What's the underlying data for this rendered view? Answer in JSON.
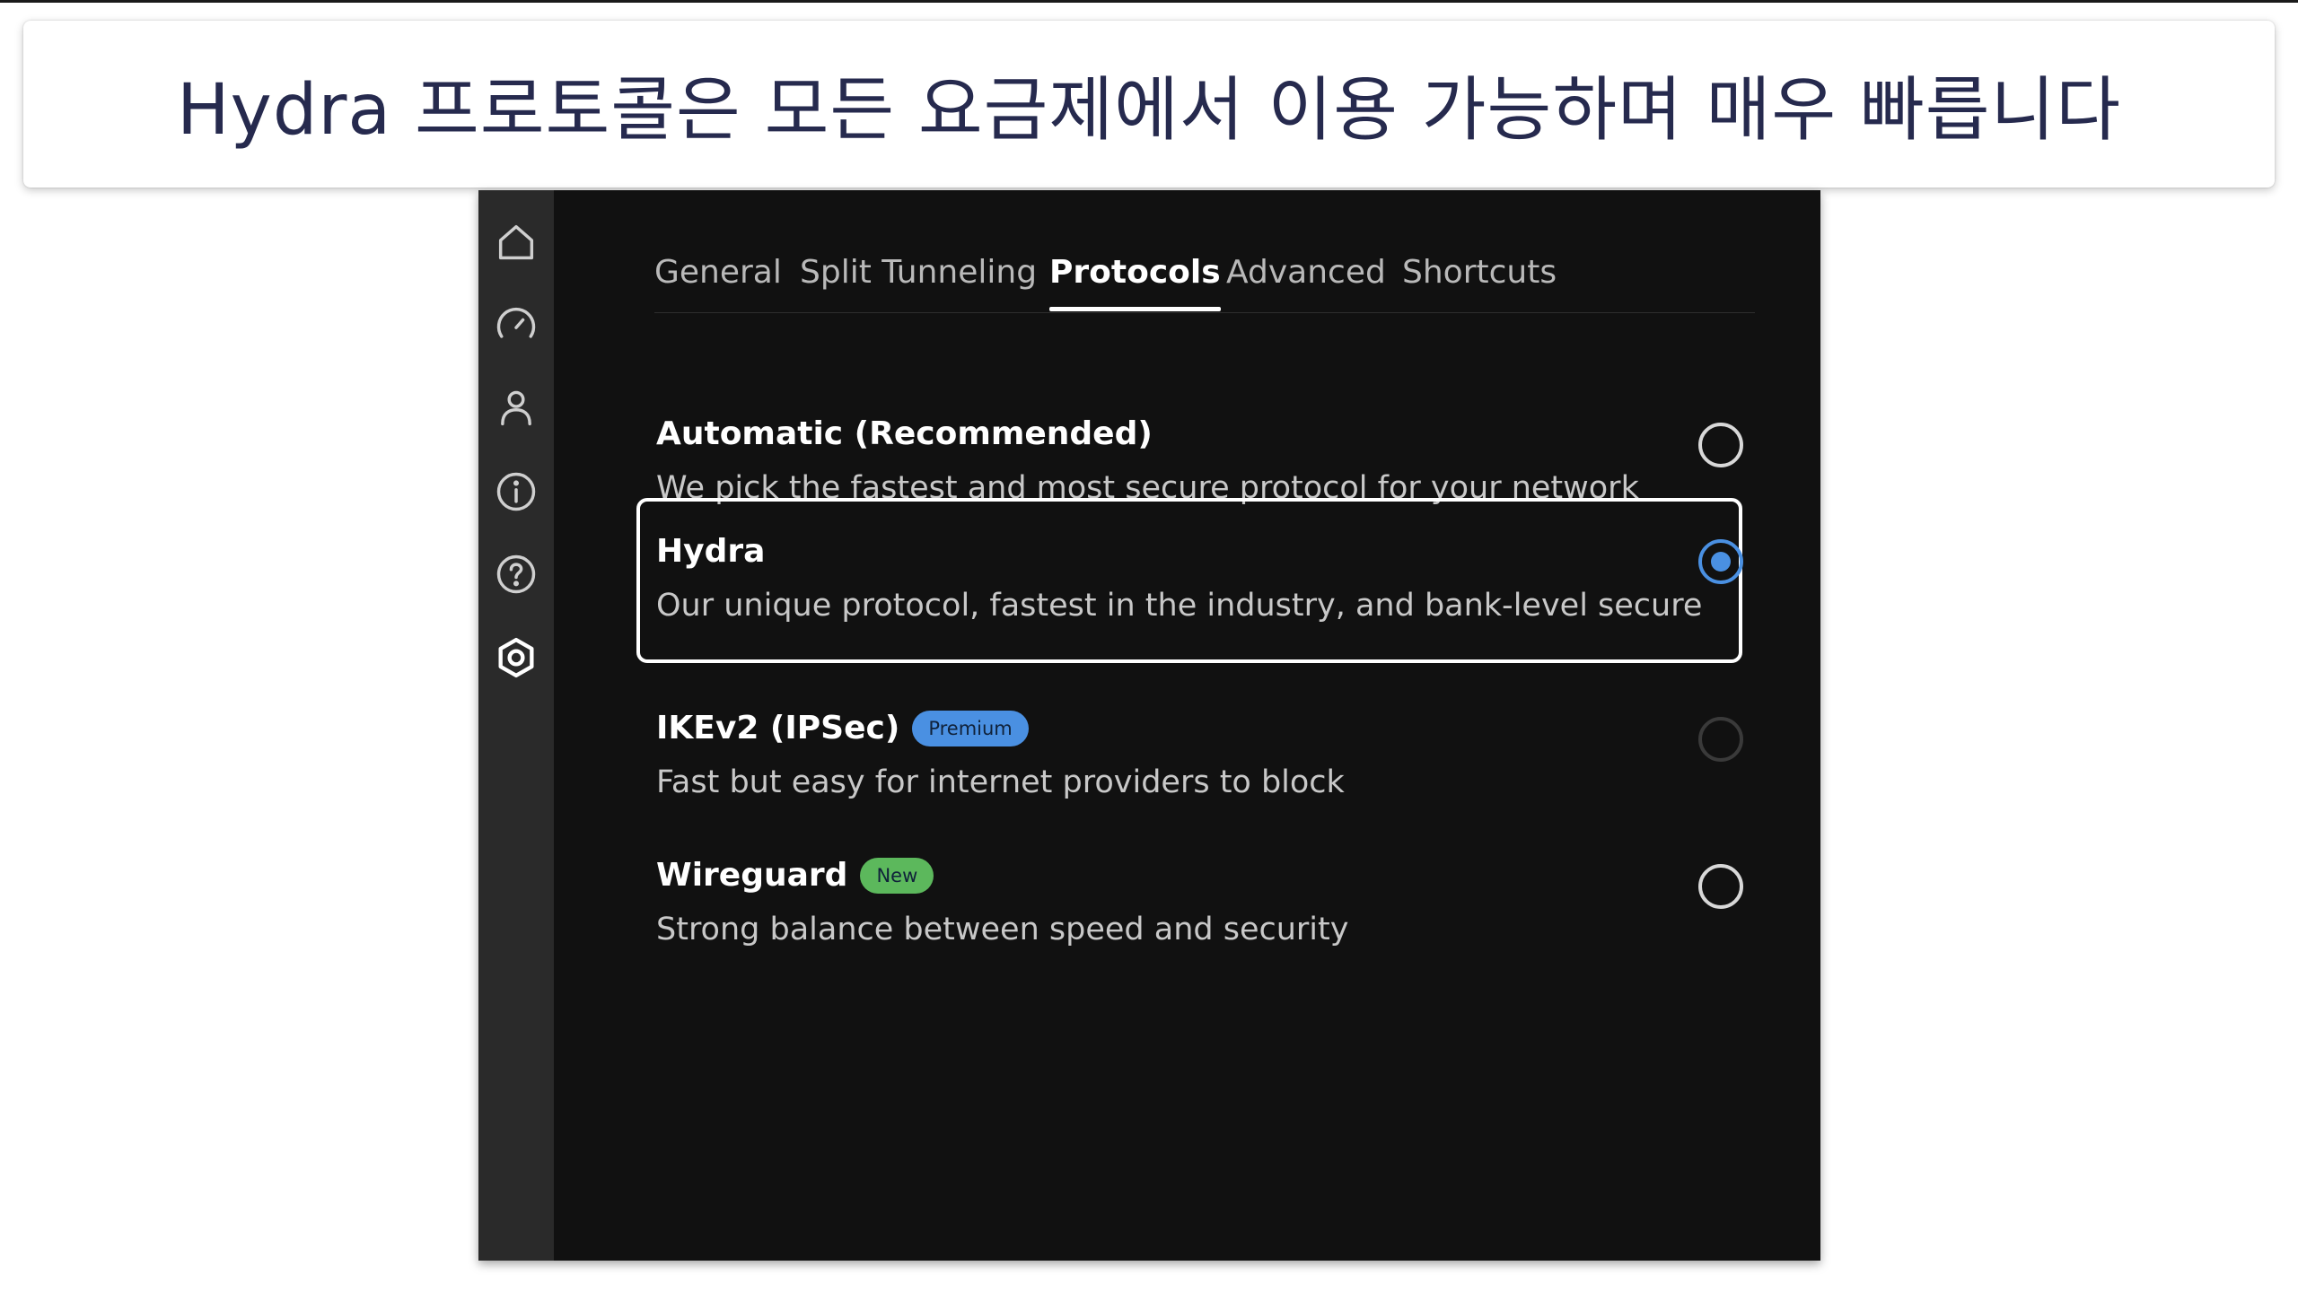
{
  "caption": {
    "text": "Hydra 프로토콜은 모든 요금제에서 이용 가능하며 매우 빠릅니다"
  },
  "sidebar": {
    "icons": [
      "home-icon",
      "speedometer-icon",
      "user-icon",
      "info-icon",
      "help-icon",
      "settings-icon"
    ],
    "active": "settings-icon"
  },
  "tabs": [
    {
      "label": "General",
      "active": false
    },
    {
      "label": "Split Tunneling",
      "active": false
    },
    {
      "label": "Protocols",
      "active": true
    },
    {
      "label": "Advanced",
      "active": false
    },
    {
      "label": "Shortcuts",
      "active": false
    }
  ],
  "protocols": [
    {
      "title": "Automatic (Recommended)",
      "description": "We pick the fastest and most secure protocol for your network",
      "selected": false
    },
    {
      "title": "Hydra",
      "description": "Our unique protocol, fastest in the industry, and bank-level secure",
      "selected": true
    },
    {
      "title": "IKEv2 (IPSec)",
      "badge": "Premium",
      "description": "Fast but easy for internet providers to block",
      "selected": false,
      "disabled": true
    },
    {
      "title": "Wireguard",
      "badge": "New",
      "description": "Strong balance between speed and security",
      "selected": false
    }
  ],
  "colors": {
    "accent": "#4a90e2",
    "premium_badge": "#4a90e2",
    "new_badge": "#5cb85c",
    "app_background": "#111111",
    "sidebar_background": "#2a2a2a",
    "caption_text": "#262a4e"
  }
}
